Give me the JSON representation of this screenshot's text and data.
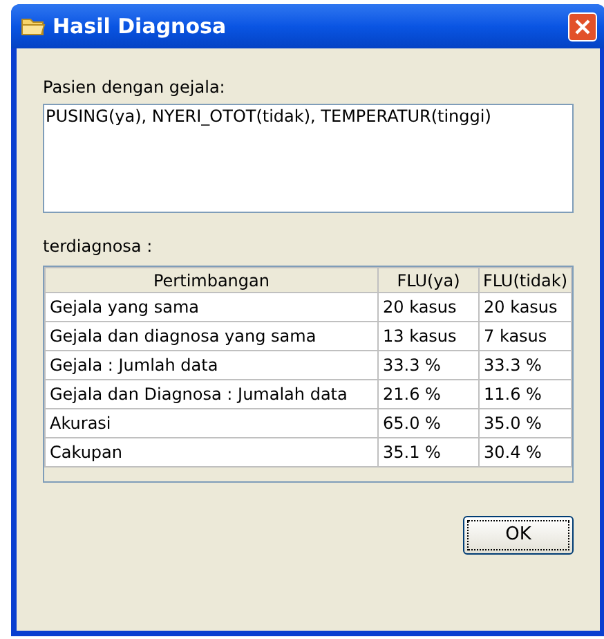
{
  "window": {
    "title": "Hasil Diagnosa"
  },
  "symptoms_label": "Pasien dengan gejala:",
  "symptoms_text": "PUSING(ya), NYERI_OTOT(tidak), TEMPERATUR(tinggi)",
  "result_label": "terdiagnosa :",
  "table": {
    "columns": [
      "Pertimbangan",
      "FLU(ya)",
      "FLU(tidak)"
    ],
    "rows": [
      [
        "Gejala yang sama",
        "20 kasus",
        "20 kasus"
      ],
      [
        "Gejala dan diagnosa yang sama",
        "13 kasus",
        "7 kasus"
      ],
      [
        "Gejala : Jumlah data",
        "33.3 %",
        "33.3 %"
      ],
      [
        "Gejala dan Diagnosa : Jumalah data",
        "21.6 %",
        "11.6 %"
      ],
      [
        "Akurasi",
        "65.0 %",
        "35.0 %"
      ],
      [
        "Cakupan",
        "35.1 %",
        "30.4 %"
      ]
    ]
  },
  "buttons": [
    "OK"
  ]
}
